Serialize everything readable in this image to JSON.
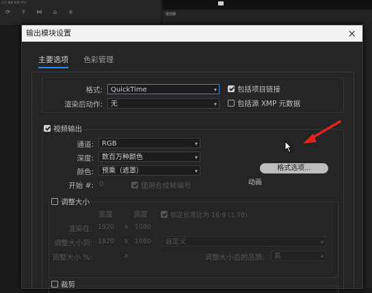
{
  "background": {
    "window_title": "文件 编辑 剪辑 序列",
    "toolbar": [
      {
        "icon": "refresh-icon",
        "label": ""
      },
      {
        "icon": "export-icon",
        "label": ""
      },
      {
        "icon": "transition-icon",
        "label": ""
      },
      {
        "icon": "title-icon",
        "label": ""
      },
      {
        "icon": "settings-icon",
        "label": ""
      }
    ],
    "right_panel_tab": "播放器"
  },
  "dialog": {
    "title": "输出模块设置",
    "close_symbol": "×",
    "tabs": [
      {
        "label": "主要选项",
        "active": true
      },
      {
        "label": "色彩管理",
        "active": false
      }
    ],
    "format": {
      "label": "格式:",
      "value": "QuickTime",
      "include_project_link": {
        "label": "包括项目链接",
        "checked": true
      }
    },
    "post_render": {
      "label": "渲染后动作:",
      "value": "无",
      "include_xmp": {
        "label": "包括源 XMP 元数据",
        "checked": false
      }
    },
    "video_output": {
      "label": "视频输出",
      "checked": true,
      "channel": {
        "label": "通道:",
        "value": "RGB"
      },
      "depth": {
        "label": "深度:",
        "value": "数百万种颜色"
      },
      "color": {
        "label": "颜色:",
        "value": "预乘（遮罩）"
      },
      "start": {
        "label": "开始 #:",
        "value": "0"
      },
      "use_comp_frame": {
        "label": "使用合成帧编号",
        "checked": true
      },
      "format_options_button": "格式选项...",
      "codec_text": "动画"
    },
    "resize": {
      "label": "调整大小",
      "checked": false,
      "col_width": "宽度",
      "col_height": "高度",
      "lock_ratio": {
        "label": "锁定长宽比为 16:9 (1.78)",
        "checked": true
      },
      "render_at": {
        "label": "渲染在:",
        "w": "1920",
        "h": "1080"
      },
      "resize_to": {
        "label": "调整大小到:",
        "w": "1920",
        "h": "1080",
        "preset": "自定义"
      },
      "resize_pct": {
        "label": "调整大小 %:",
        "x": "x"
      },
      "quality": {
        "label": "调整大小后的品质:",
        "value": "高"
      }
    },
    "crop": {
      "label": "裁剪",
      "checked": false
    }
  },
  "annotation": {
    "arrow_color": "#e8231c"
  }
}
